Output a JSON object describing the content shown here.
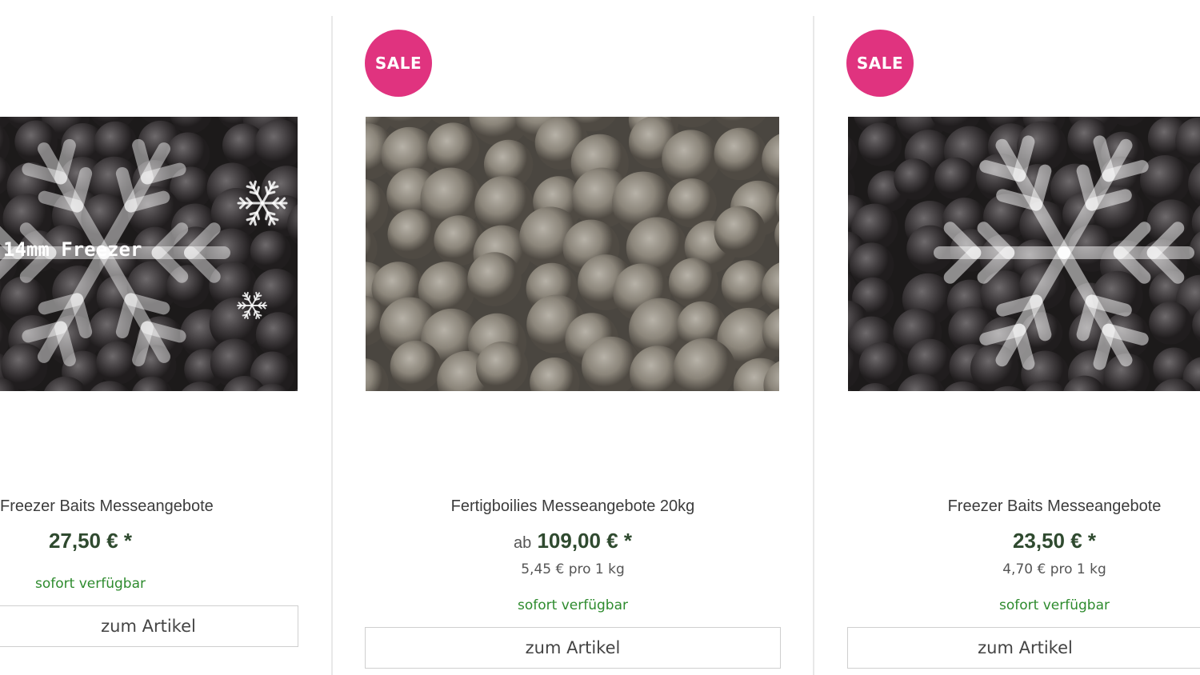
{
  "products": [
    {
      "title": "Freezer Baits Messeangebote",
      "price_prefix": "",
      "price": "27,50 € *",
      "unit_price": "",
      "availability": "sofort verfügbar",
      "button_label": "zum Artikel",
      "image_overlay_text": "14mm Freezer",
      "sale_badge": ""
    },
    {
      "title": "Fertigboilies Messeangebote 20kg",
      "price_prefix": "ab",
      "price": "109,00 € *",
      "unit_price": "5,45 € pro 1 kg",
      "availability": "sofort verfügbar",
      "button_label": "zum Artikel",
      "sale_badge": "SALE"
    },
    {
      "title": "Freezer Baits Messeangebote",
      "price_prefix": "",
      "price": "23,50 € *",
      "unit_price": "4,70 € pro 1 kg",
      "availability": "sofort verfügbar",
      "button_label": "zum Artikel",
      "sale_badge": "SALE"
    }
  ],
  "colors": {
    "sale_badge": "#e0337f",
    "availability": "#2e8b2e",
    "price": "#2f4a2f"
  }
}
